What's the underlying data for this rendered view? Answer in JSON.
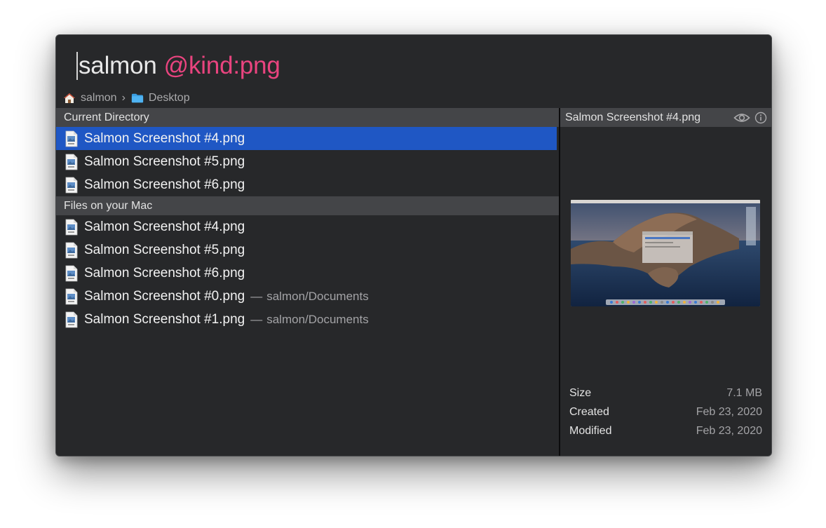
{
  "search": {
    "query_text": "salmon",
    "query_token": "@kind:png"
  },
  "breadcrumb": {
    "items": [
      {
        "label": "salmon",
        "icon": "home-icon"
      },
      {
        "label": "Desktop",
        "icon": "folder-icon"
      }
    ],
    "separator": "›"
  },
  "sections": [
    {
      "title": "Current Directory",
      "items": [
        {
          "name": "Salmon Screenshot #4.png",
          "selected": true
        },
        {
          "name": "Salmon Screenshot #5.png"
        },
        {
          "name": "Salmon Screenshot #6.png"
        }
      ]
    },
    {
      "title": "Files on your Mac",
      "items": [
        {
          "name": "Salmon Screenshot #4.png"
        },
        {
          "name": "Salmon Screenshot #5.png"
        },
        {
          "name": "Salmon Screenshot #6.png"
        },
        {
          "name": "Salmon Screenshot #0.png",
          "dash": "—",
          "location": "salmon/Documents"
        },
        {
          "name": "Salmon Screenshot #1.png",
          "dash": "—",
          "location": "salmon/Documents"
        }
      ]
    }
  ],
  "preview": {
    "title": "Salmon Screenshot #4.png",
    "actions": [
      "eye-icon",
      "info-icon"
    ],
    "meta": [
      {
        "label": "Size",
        "value": "7.1 MB"
      },
      {
        "label": "Created",
        "value": "Feb 23, 2020"
      },
      {
        "label": "Modified",
        "value": "Feb 23, 2020"
      }
    ]
  },
  "colors": {
    "window_bg": "#27282a",
    "section_bg": "#444548",
    "selection": "#1f57c4",
    "token_accent": "#e9447f"
  }
}
